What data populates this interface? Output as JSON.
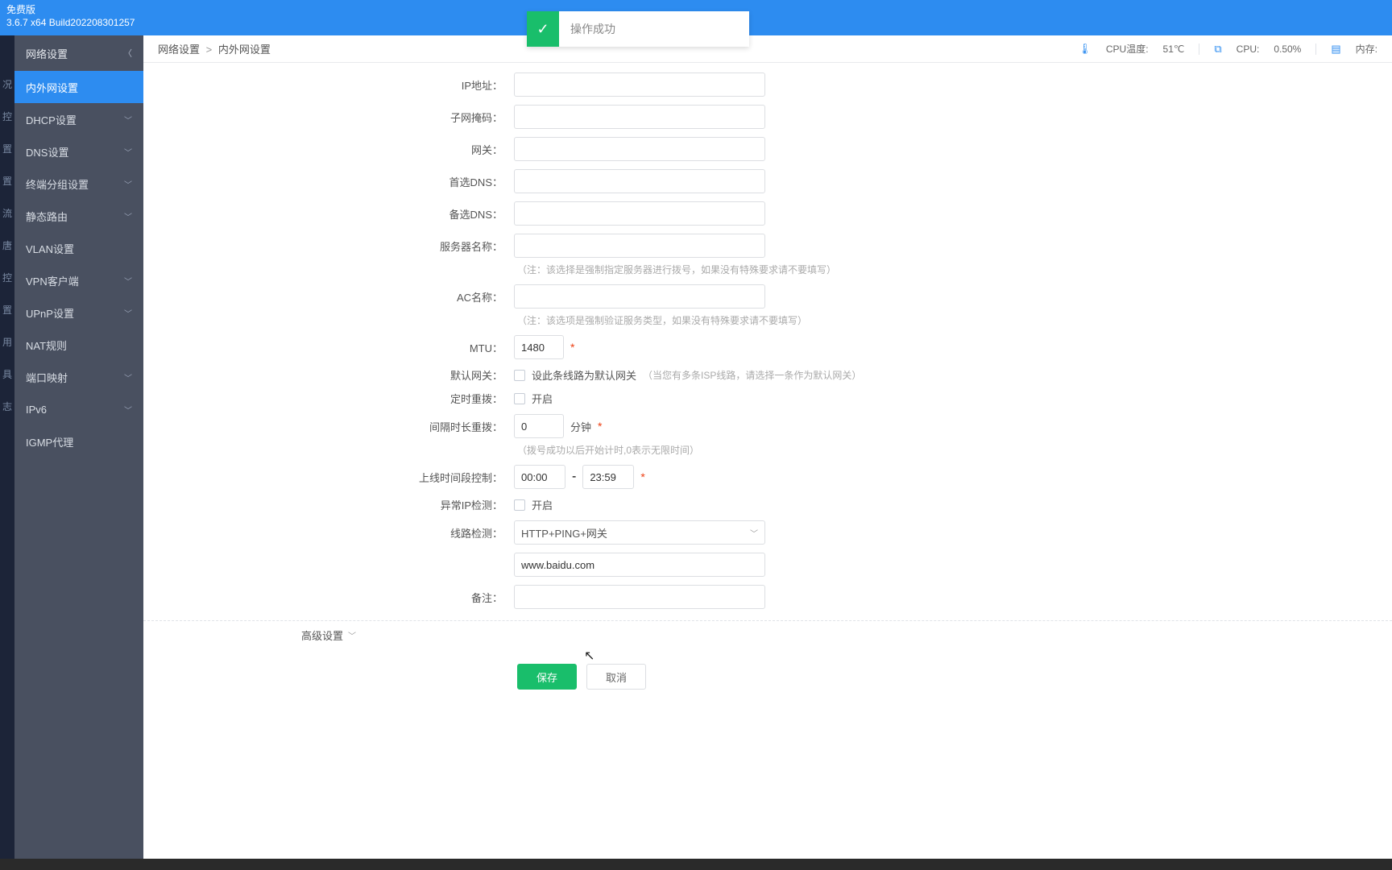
{
  "header": {
    "edition": "免费版",
    "build": "3.6.7 x64 Build202208301257"
  },
  "toast": {
    "icon": "✓",
    "message": "操作成功"
  },
  "sidebar": {
    "title": "网络设置",
    "items": [
      {
        "label": "内外网设置",
        "active": true,
        "expandable": false
      },
      {
        "label": "DHCP设置",
        "active": false,
        "expandable": true
      },
      {
        "label": "DNS设置",
        "active": false,
        "expandable": true
      },
      {
        "label": "终端分组设置",
        "active": false,
        "expandable": true
      },
      {
        "label": "静态路由",
        "active": false,
        "expandable": true
      },
      {
        "label": "VLAN设置",
        "active": false,
        "expandable": false
      },
      {
        "label": "VPN客户端",
        "active": false,
        "expandable": true
      },
      {
        "label": "UPnP设置",
        "active": false,
        "expandable": true
      },
      {
        "label": "NAT规则",
        "active": false,
        "expandable": false
      },
      {
        "label": "端口映射",
        "active": false,
        "expandable": true
      },
      {
        "label": "IPv6",
        "active": false,
        "expandable": true
      },
      {
        "label": "IGMP代理",
        "active": false,
        "expandable": false
      }
    ]
  },
  "breadcrumb": {
    "root": "网络设置",
    "sep": ">",
    "leaf": "内外网设置"
  },
  "status": {
    "cpu_temp_label": "CPU温度:",
    "cpu_temp_value": "51℃",
    "cpu_label": "CPU:",
    "cpu_value": "0.50%",
    "mem_label": "内存:"
  },
  "form": {
    "ip_label": "IP地址：",
    "ip_value": "",
    "mask_label": "子网掩码：",
    "mask_value": "",
    "gw_label": "网关：",
    "gw_value": "",
    "dns1_label": "首选DNS：",
    "dns1_value": "",
    "dns2_label": "备选DNS：",
    "dns2_value": "",
    "srv_label": "服务器名称：",
    "srv_value": "",
    "srv_hint": "（注：该选择是强制指定服务器进行拨号，如果没有特殊要求请不要填写）",
    "ac_label": "AC名称：",
    "ac_value": "",
    "ac_hint": "（注：该选项是强制验证服务类型，如果没有特殊要求请不要填写）",
    "mtu_label": "MTU：",
    "mtu_value": "1480",
    "defgw_label": "默认网关：",
    "defgw_cbx_label": "设此条线路为默认网关",
    "defgw_hint": "（当您有多条ISP线路，请选择一条作为默认网关）",
    "redial_label": "定时重拨：",
    "redial_cbx_label": "开启",
    "interval_label": "间隔时长重拨：",
    "interval_value": "0",
    "interval_unit": "分钟",
    "interval_hint": "（拨号成功以后开始计时,0表示无限时间）",
    "timectl_label": "上线时间段控制：",
    "time_from": "00:00",
    "time_sep": "-",
    "time_to": "23:59",
    "abn_label": "异常IP检测：",
    "abn_cbx_label": "开启",
    "linechk_label": "线路检测：",
    "linechk_value": "HTTP+PING+网关",
    "linechk_url": "www.baidu.com",
    "remark_label": "备注：",
    "remark_value": "",
    "star": "*"
  },
  "advanced_label": "高级设置",
  "buttons": {
    "save": "保存",
    "cancel": "取消"
  }
}
